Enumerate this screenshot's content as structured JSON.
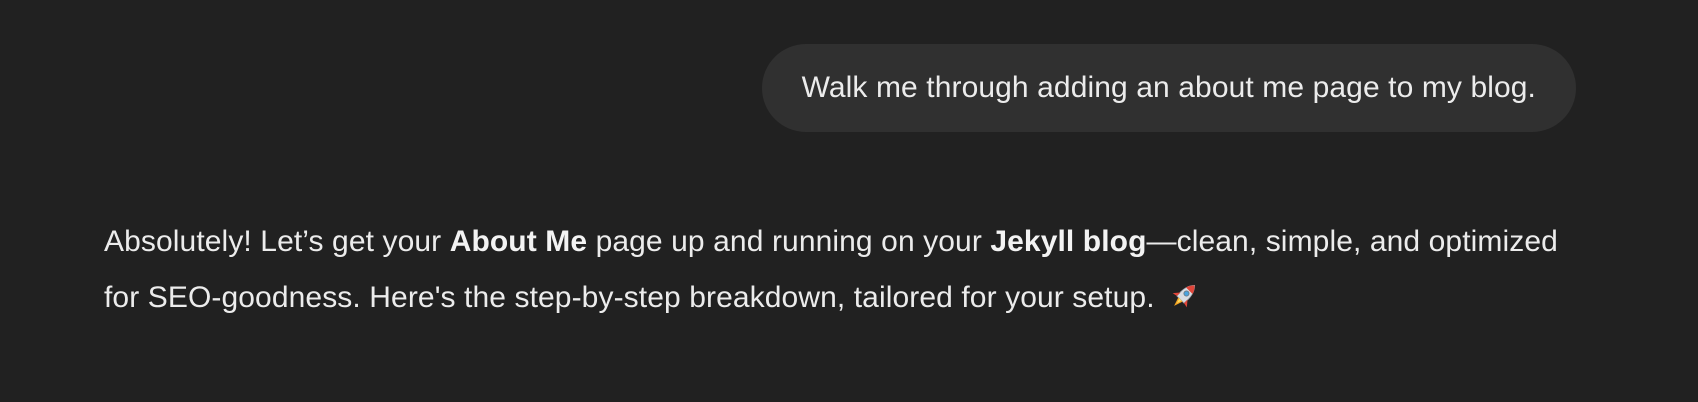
{
  "user_message": {
    "text": "Walk me through adding an about me page to my blog."
  },
  "assistant_message": {
    "part1": "Absolutely! Let’s get your ",
    "bold1": "About Me",
    "part2": " page up and running on your ",
    "bold2": "Jekyll blog",
    "part3": "—clean, simple, and optimized for SEO-goodness. Here's the step-by-step breakdown, tailored for your setup. ",
    "emoji_icon": "rocket-icon"
  },
  "colors": {
    "background": "#212121",
    "user_bubble": "#303030",
    "text": "#ececec"
  }
}
